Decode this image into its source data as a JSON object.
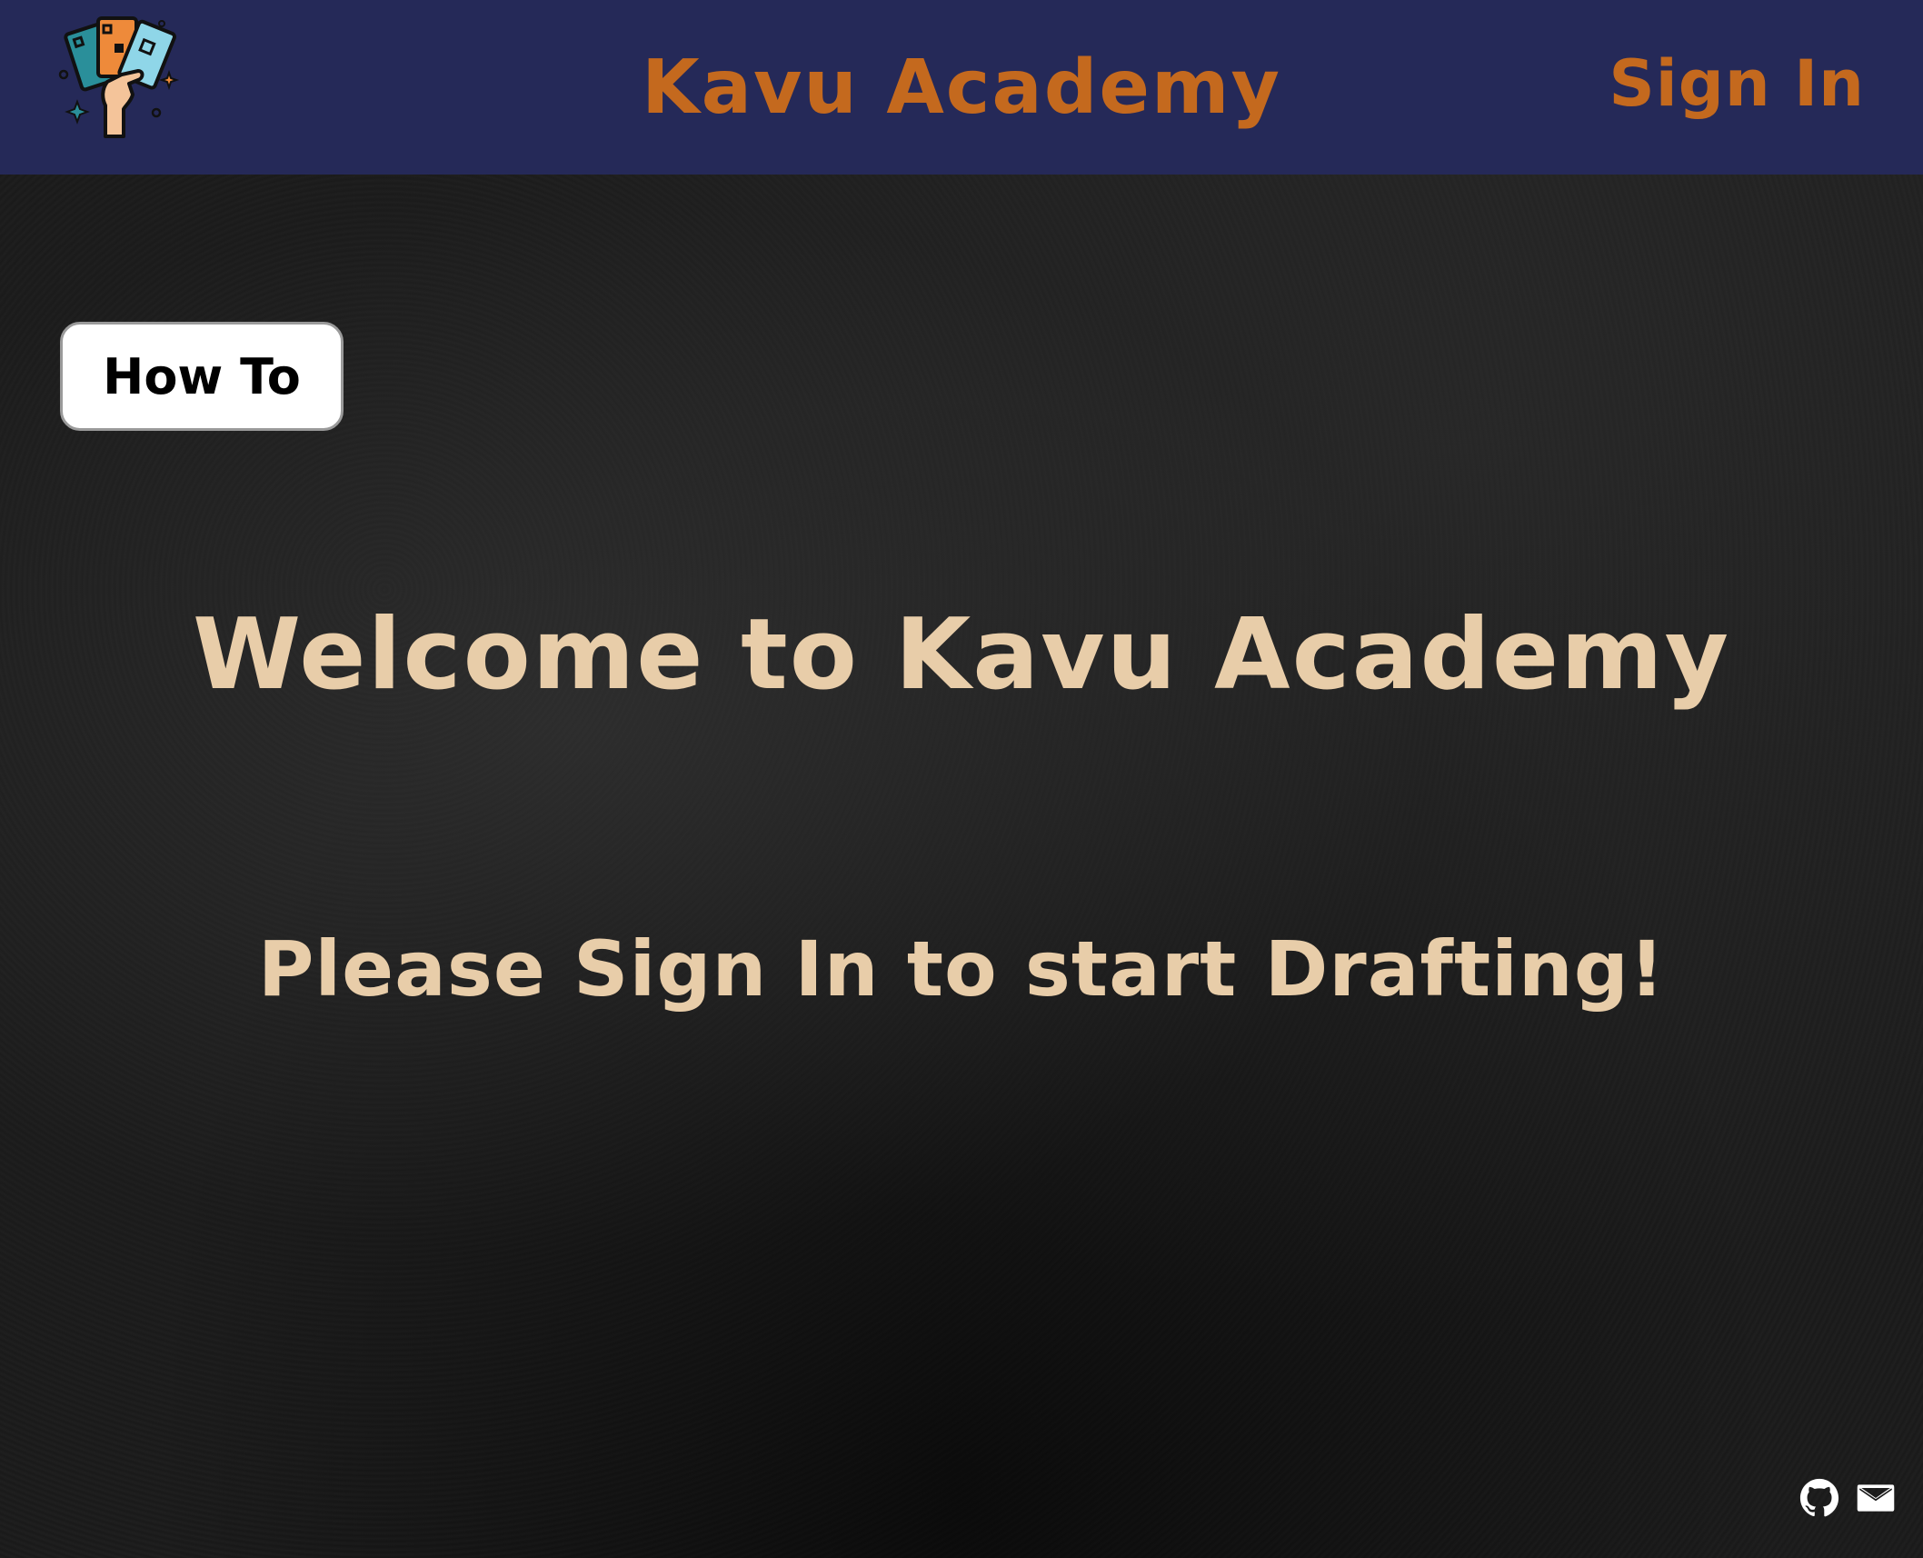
{
  "header": {
    "title": "Kavu Academy",
    "sign_in_label": "Sign In",
    "logo_icon": "hand-holding-cards-icon"
  },
  "main": {
    "how_to_label": "How To",
    "welcome": "Welcome to Kavu Academy",
    "prompt": "Please Sign In to start Drafting!"
  },
  "footer": {
    "icons": [
      "github-icon",
      "mail-icon"
    ]
  },
  "colors": {
    "navbar_bg": "#252958",
    "accent_orange": "#c4691e",
    "hero_text": "#e8cda9",
    "button_bg": "#ffffff"
  }
}
